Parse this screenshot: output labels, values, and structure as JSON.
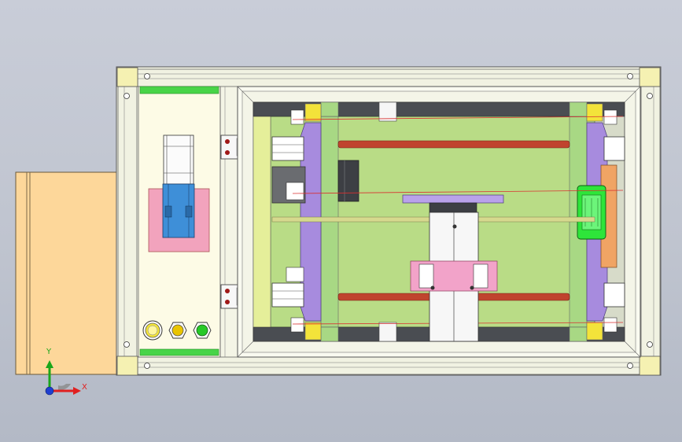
{
  "viewport": {
    "background_top": "#c9cdd8",
    "background_bottom": "#b3b9c6"
  },
  "triad": {
    "x_label": "X",
    "y_label": "Y",
    "x_color": "#e02020",
    "y_color": "#1aa61a",
    "origin_color": "#1f3fd0"
  },
  "colors": {
    "frame": "#f4f5e6",
    "corner_block": "#f5f1b2",
    "control_panel": "#fdfbe6",
    "green_strip": "#48d448",
    "base_plate": "#b9dc86",
    "tan_box": "#fdd79a",
    "pink_pad": "#f2a3bd",
    "motor_blue": "#3e8fd8",
    "lavender": "#a78bde",
    "red_rod": "#c0442e",
    "bright_green_box": "#2ee53a",
    "orange_block": "#f0a464"
  },
  "buttons": [
    {
      "name": "yellow",
      "color": "#f5e63a"
    },
    {
      "name": "amber",
      "color": "#e9c400"
    },
    {
      "name": "green",
      "color": "#27c927"
    }
  ]
}
